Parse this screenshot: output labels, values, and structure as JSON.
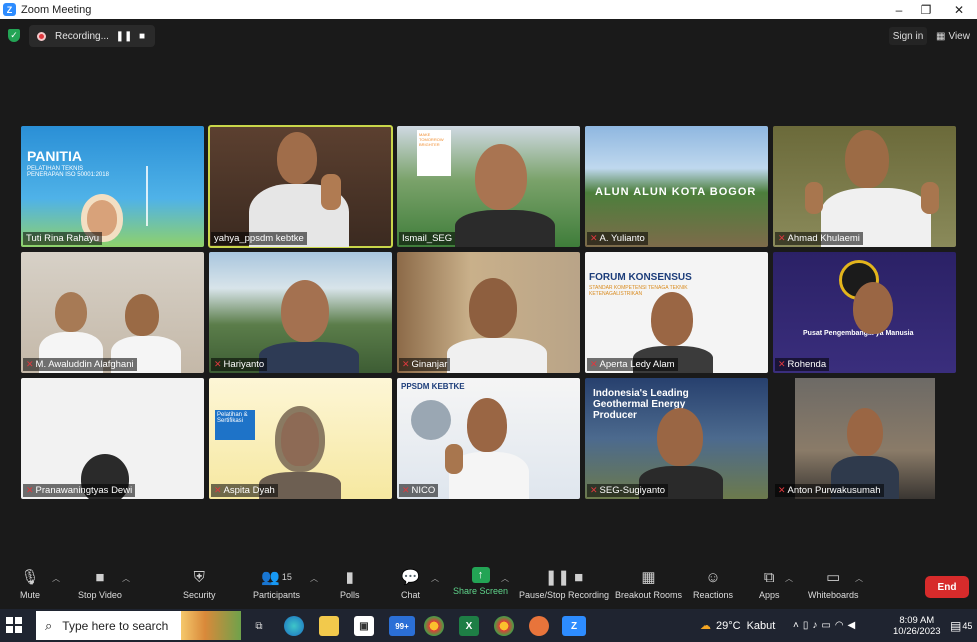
{
  "window": {
    "title": "Zoom Meeting",
    "controls": [
      "–",
      "❐",
      "✕"
    ]
  },
  "recording": {
    "label": "Recording...",
    "pause": "❚❚",
    "stop": "■"
  },
  "topbar": {
    "signin": "Sign in",
    "view": "View"
  },
  "participants": [
    {
      "name": "Tuti Rina Rahayu",
      "muted": false,
      "slide": {
        "heading": "PANITIA",
        "sub": "PELATIHAN TEKNIS PENERAPAN ISO 50001:2018"
      }
    },
    {
      "name": "yahya_ppsdm kebtke",
      "muted": false,
      "active": true
    },
    {
      "name": "Ismail_SEG",
      "muted": false,
      "bg_text": "MAKE TOMORROW BRIGHTER"
    },
    {
      "name": "A. Yulianto",
      "muted": true,
      "bg_text": "ALUN ALUN KOTA BOGOR"
    },
    {
      "name": "Ahmad Khulaemi",
      "muted": true
    },
    {
      "name": "M. Awaluddin Alafghani",
      "muted": true
    },
    {
      "name": "Hariyanto",
      "muted": true
    },
    {
      "name": "Ginanjar",
      "muted": true
    },
    {
      "name": "Aperta Ledy Alam",
      "muted": true,
      "slide": {
        "heading": "FORUM KONSENSUS",
        "sub": "STANDAR KOMPETENSI TENAGA TEKNIK KETENAGALISTRIKAN"
      }
    },
    {
      "name": "Rohenda",
      "muted": true,
      "bg_text": "Pusat Pengembang... ya Manusia"
    },
    {
      "name": "Pranawaningtyas Dewi",
      "muted": true
    },
    {
      "name": "Aspita Dyah",
      "muted": true,
      "bg_text": "Pelatihan & Sertifikasi"
    },
    {
      "name": "NICO",
      "muted": true,
      "bg_text": "PPSDM KEBTKE"
    },
    {
      "name": "SEG-Sugiyanto",
      "muted": true,
      "bg_text": "Indonesia's Leading Geothermal Energy Producer"
    },
    {
      "name": "Anton Purwakusumah",
      "muted": true
    }
  ],
  "toolbar": {
    "mute": "Mute",
    "stop_video": "Stop Video",
    "security": "Security",
    "participants": "Participants",
    "participants_count": "15",
    "polls": "Polls",
    "chat": "Chat",
    "share_screen": "Share Screen",
    "pause_stop_recording": "Pause/Stop Recording",
    "breakout_rooms": "Breakout Rooms",
    "reactions": "Reactions",
    "apps": "Apps",
    "whiteboards": "Whiteboards",
    "end": "End"
  },
  "taskbar": {
    "search_placeholder": "Type here to search",
    "mail_badge": "99+",
    "weather": "29°C",
    "weather_desc": "Kabut",
    "time": "8:09 AM",
    "date": "10/26/2023",
    "notif_count": "45"
  },
  "colors": {
    "accent": "#2D8CFF",
    "end": "#d72b2b",
    "share": "#23a455",
    "active_speaker": "#c9d64a"
  }
}
